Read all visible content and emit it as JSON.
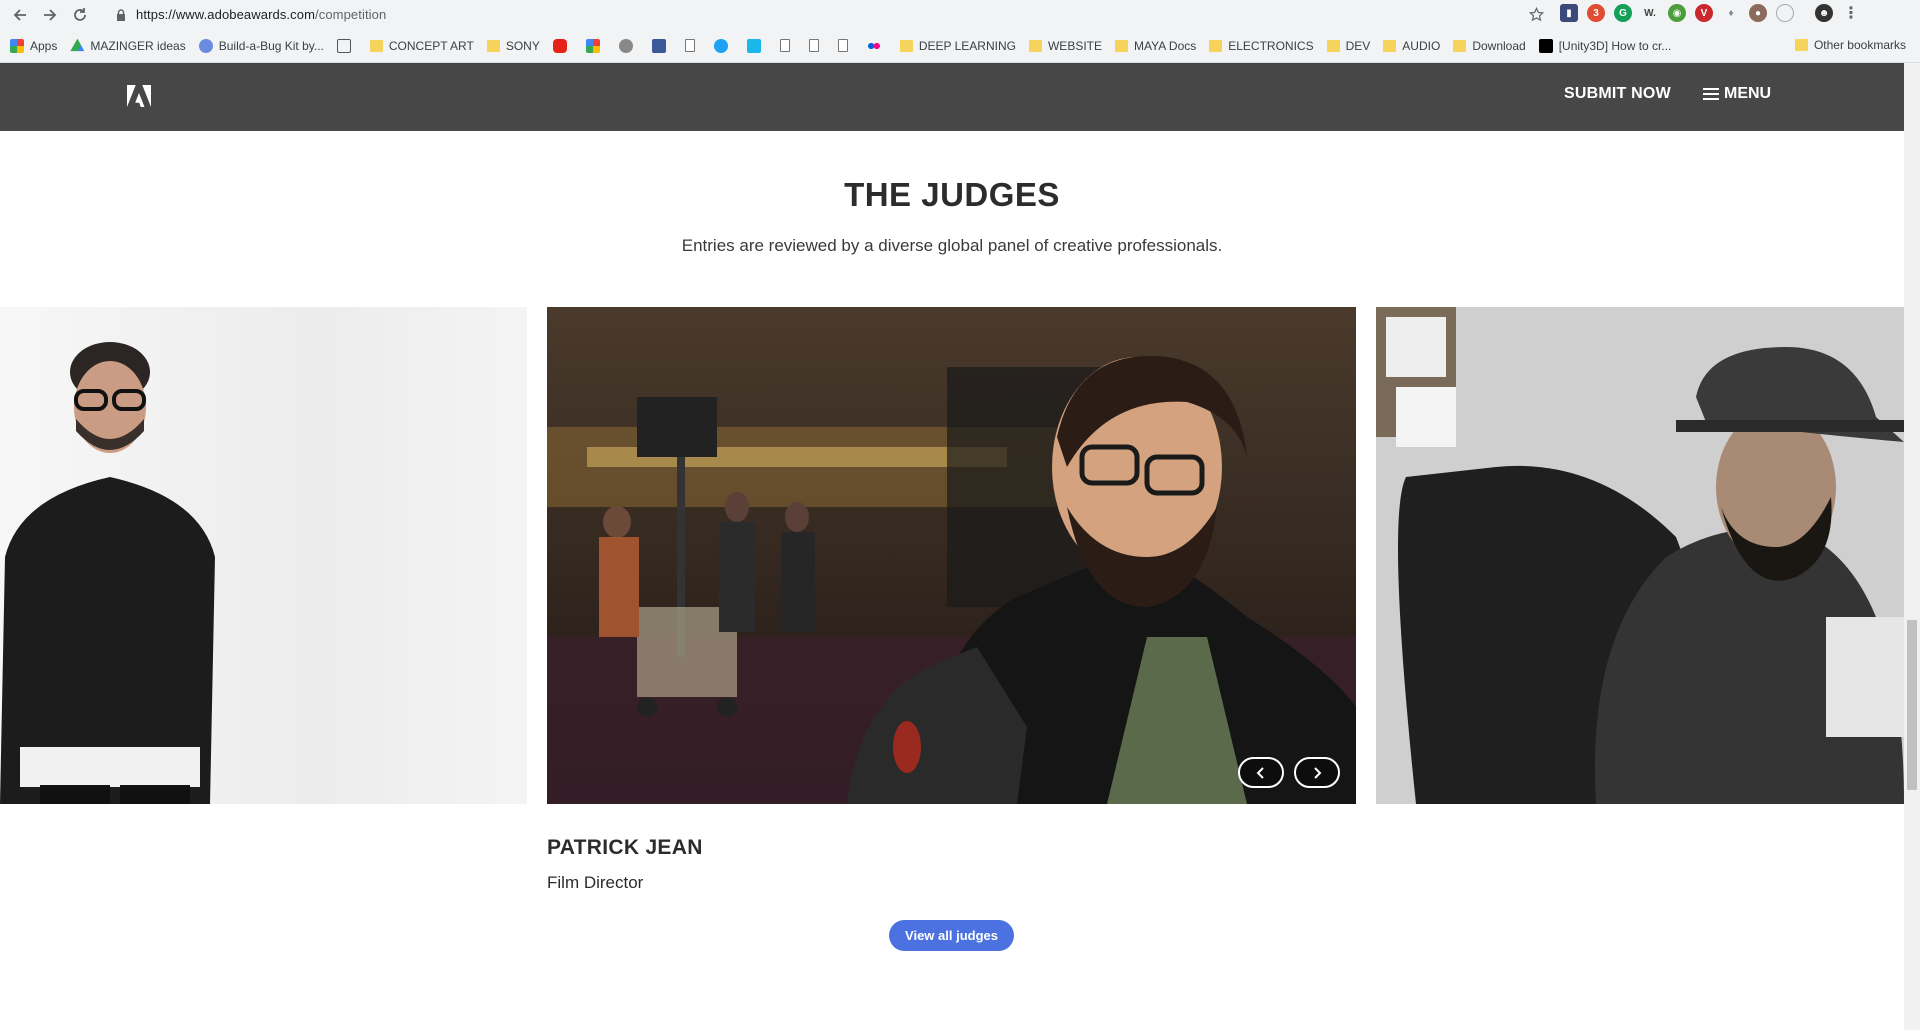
{
  "browser": {
    "url_host": "https://www.adobeawards.com",
    "url_path": "/competition",
    "bookmarks": [
      {
        "label": "Apps",
        "kind": "apps"
      },
      {
        "label": "MAZINGER ideas",
        "kind": "drive"
      },
      {
        "label": "Build-a-Bug Kit by...",
        "kind": "site"
      },
      {
        "label": "",
        "kind": "site-ls"
      },
      {
        "label": "CONCEPT ART",
        "kind": "folder"
      },
      {
        "label": "SONY",
        "kind": "folder"
      },
      {
        "label": "",
        "kind": "youtube"
      },
      {
        "label": "",
        "kind": "photos"
      },
      {
        "label": "",
        "kind": "apple"
      },
      {
        "label": "",
        "kind": "facebook"
      },
      {
        "label": "",
        "kind": "page"
      },
      {
        "label": "",
        "kind": "twitter"
      },
      {
        "label": "",
        "kind": "vimeo"
      },
      {
        "label": "",
        "kind": "page"
      },
      {
        "label": "",
        "kind": "page"
      },
      {
        "label": "",
        "kind": "page"
      },
      {
        "label": "",
        "kind": "flickr"
      },
      {
        "label": "DEEP LEARNING",
        "kind": "folder"
      },
      {
        "label": "WEBSITE",
        "kind": "folder"
      },
      {
        "label": "MAYA Docs",
        "kind": "folder"
      },
      {
        "label": "ELECTRONICS",
        "kind": "folder"
      },
      {
        "label": "DEV",
        "kind": "folder"
      },
      {
        "label": "AUDIO",
        "kind": "folder"
      },
      {
        "label": "Download",
        "kind": "folder"
      },
      {
        "label": "[Unity3D] How to cr...",
        "kind": "medium"
      }
    ],
    "other_bookmarks": "Other bookmarks"
  },
  "header": {
    "submit_label": "SUBMIT NOW",
    "menu_label": "MENU"
  },
  "judges": {
    "title": "THE JUDGES",
    "subtitle": "Entries are reviewed by a diverse global panel of creative professionals.",
    "current": {
      "name": "PATRICK JEAN",
      "role": "Film Director"
    },
    "view_all_label": "View all judges"
  }
}
